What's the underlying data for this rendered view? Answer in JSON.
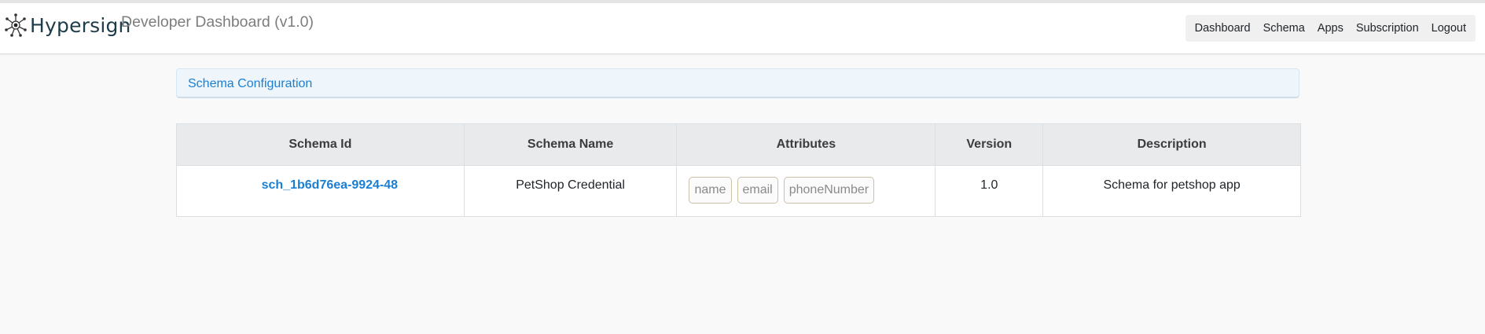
{
  "brand": {
    "name": "Hypersign",
    "title": "Developer Dashboard (v1.0)"
  },
  "nav": {
    "items": [
      "Dashboard",
      "Schema",
      "Apps",
      "Subscription",
      "Logout"
    ]
  },
  "card": {
    "title": "Schema Configuration"
  },
  "table": {
    "headers": [
      "Schema Id",
      "Schema Name",
      "Attributes",
      "Version",
      "Description"
    ],
    "rows": [
      {
        "schema_id": "sch_1b6d76ea-9924-48",
        "schema_name": "PetShop Credential",
        "attributes": [
          "name",
          "email",
          "phoneNumber"
        ],
        "version": "1.0",
        "description": "Schema for petshop app"
      }
    ]
  },
  "colors": {
    "accent": "#1a7fd4",
    "brand_text": "#1f3c4a"
  }
}
